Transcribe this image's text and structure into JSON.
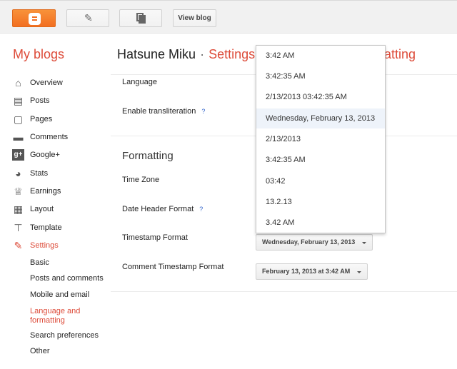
{
  "toolbar": {
    "view_blog_label": "View blog",
    "accent_color": "#f26f21"
  },
  "header": {
    "my_blogs": "My blogs",
    "blog_name": "Hatsune Miku",
    "separator": "·",
    "section": "Settings",
    "section_tail": "atting"
  },
  "sidebar": {
    "items": [
      {
        "label": "Overview",
        "icon": "home-icon"
      },
      {
        "label": "Posts",
        "icon": "posts-icon"
      },
      {
        "label": "Pages",
        "icon": "pages-icon"
      },
      {
        "label": "Comments",
        "icon": "comment-icon"
      },
      {
        "label": "Google+",
        "icon": "google-plus-icon"
      },
      {
        "label": "Stats",
        "icon": "pie-chart-icon"
      },
      {
        "label": "Earnings",
        "icon": "trophy-icon"
      },
      {
        "label": "Layout",
        "icon": "layout-icon"
      },
      {
        "label": "Template",
        "icon": "paint-roller-icon"
      },
      {
        "label": "Settings",
        "icon": "wrench-icon"
      }
    ],
    "sub_items": [
      {
        "label": "Basic"
      },
      {
        "label": "Posts and comments"
      },
      {
        "label": "Mobile and email"
      },
      {
        "label": "Language and formatting"
      },
      {
        "label": "Search preferences"
      },
      {
        "label": "Other"
      }
    ]
  },
  "main": {
    "language_label": "Language",
    "transliteration_label": "Enable transliteration",
    "help_mark": "?",
    "formatting_heading": "Formatting",
    "time_zone_label": "Time Zone",
    "date_header_label": "Date Header Format",
    "timestamp_label": "Timestamp Format",
    "timestamp_value": "Wednesday, February 13, 2013",
    "comment_timestamp_label": "Comment Timestamp Format",
    "comment_timestamp_value": "February 13, 2013 at 3:42 AM"
  },
  "dropdown": {
    "options": [
      "3:42 AM",
      "3:42:35 AM",
      "2/13/2013 03:42:35 AM",
      "Wednesday, February 13, 2013",
      "2/13/2013",
      "3:42:35 AM",
      "03:42",
      "13.2.13",
      "3.42 AM"
    ],
    "selected": "Wednesday, February 13, 2013"
  }
}
